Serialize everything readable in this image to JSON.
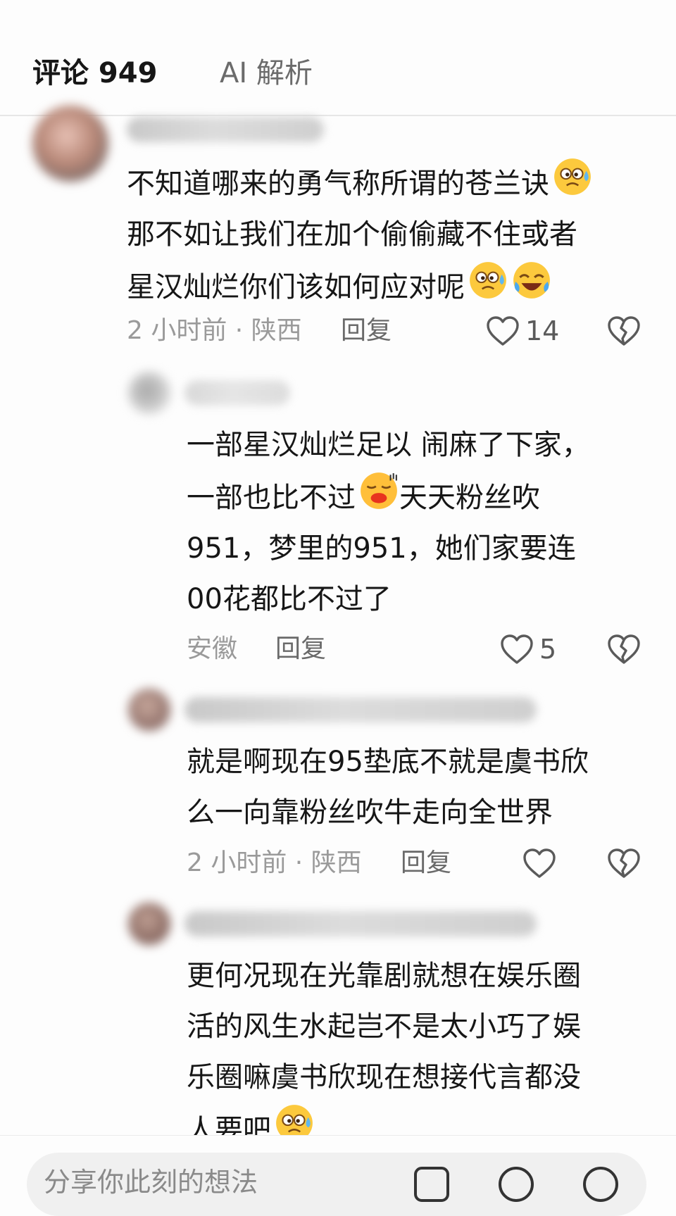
{
  "tabs": {
    "comments": "评论 949",
    "ai": "AI 解析"
  },
  "comments": [
    {
      "username": "…Qiyan",
      "lines": [
        "不知道哪来的勇气称所谓的苍兰诀",
        "那不如让我们在加个偷偷藏不住或者",
        "星汉灿烂你们该如何应对呢"
      ],
      "meta": "2 小时前 · 陕西",
      "reply": "回复",
      "likes": "14"
    },
    {
      "lines": [
        "一部星汉灿烂足以 闹麻了下家，",
        "一部也比不过",
        "天天粉丝吹",
        "951，梦里的951，她们家要连",
        "00花都比不过了"
      ],
      "meta": "安徽",
      "reply": "回复",
      "likes": "5"
    },
    {
      "lines": [
        "就是啊现在95垫底不就是虞书欣",
        "么一向靠粉丝吹牛走向全世界"
      ],
      "meta": "2 小时前 · 陕西",
      "reply": "回复",
      "likes": ""
    },
    {
      "lines": [
        "更何况现在光靠剧就想在娱乐圈",
        "活的风生水起岂不是太小巧了娱",
        "乐圈嘛虞书欣现在想接代言都没",
        "人要吧"
      ]
    }
  ],
  "input": {
    "placeholder": "分享你此刻的想法"
  },
  "icons": {
    "like": "heart-outline-icon",
    "dislike": "broken-heart-icon",
    "emoji_sweat": "sweat-smile-emoji",
    "emoji_laugh": "rofl-emoji",
    "emoji_kiss": "kissing-emoji",
    "image": "image-icon",
    "at": "at-icon",
    "smile": "smile-icon"
  },
  "colors": {
    "text": "#161616",
    "muted": "#9a9a9a",
    "icon": "#5a5a5a",
    "divider": "#e6e6e6"
  }
}
